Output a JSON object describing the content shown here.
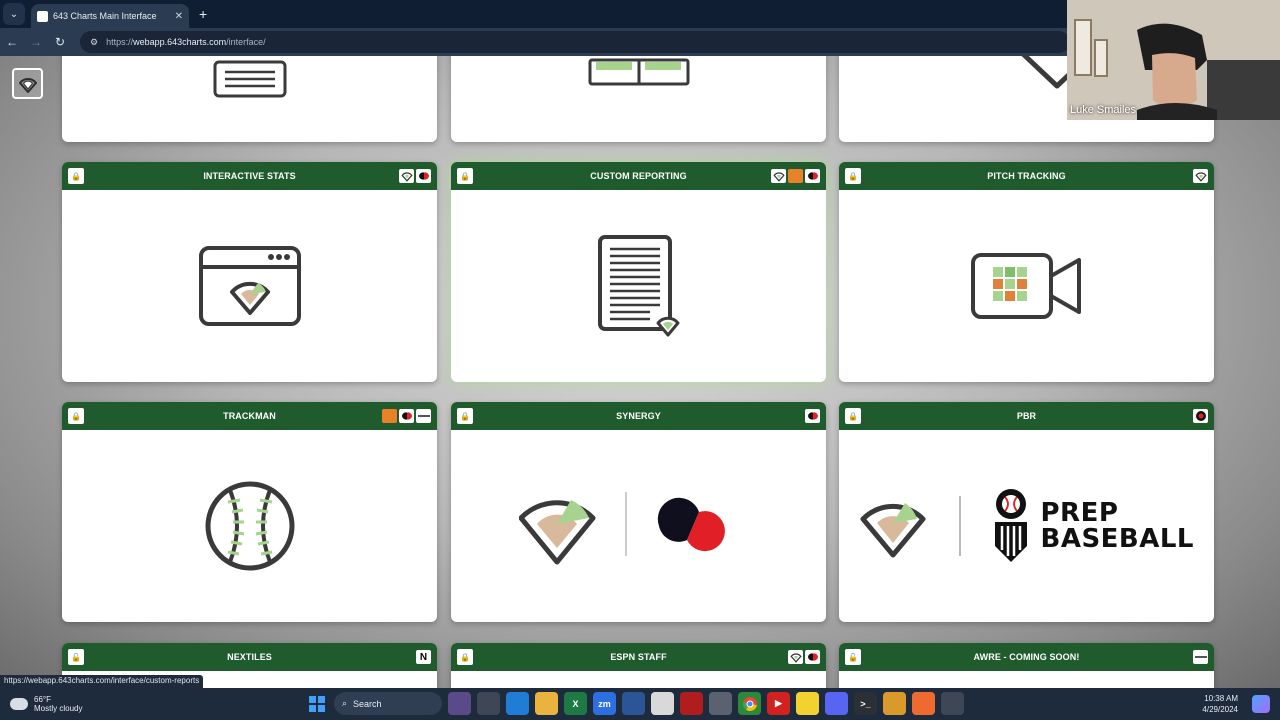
{
  "browser": {
    "tab_title": "643 Charts Main Interface",
    "url_prefix": "https://",
    "url_host": "webapp.643charts.com",
    "url_path": "/interface/"
  },
  "cards": [
    {
      "title": "INTERACTIVE STATS",
      "icon": "browser-window-icon",
      "badges": [
        "643-logo",
        "synergy"
      ]
    },
    {
      "title": "CUSTOM REPORTING",
      "icon": "report-document-icon",
      "badges": [
        "643-logo",
        "orange",
        "synergy"
      ]
    },
    {
      "title": "PITCH TRACKING",
      "icon": "video-camera-icon",
      "badges": [
        "643-logo"
      ]
    },
    {
      "title": "TRACKMAN",
      "icon": "baseball-icon",
      "badges": [
        "orange",
        "synergy",
        "trackman"
      ]
    },
    {
      "title": "SYNERGY",
      "icon": "synergy-logo",
      "badges": [
        "synergy"
      ]
    },
    {
      "title": "PBR",
      "icon": "prep-baseball-logo",
      "badges": [
        "pbr"
      ]
    },
    {
      "title": "NEXTILES",
      "icon": "",
      "badges": [
        "nextiles-n"
      ]
    },
    {
      "title": "ESPN STAFF",
      "icon": "",
      "badges": [
        "643-logo",
        "synergy"
      ]
    },
    {
      "title": "AWRE - COMING SOON!",
      "icon": "",
      "badges": [
        "awre"
      ]
    }
  ],
  "pbr_logo": {
    "line1": "PREP",
    "line2": "BASEBALL"
  },
  "nextiles_badge": "N",
  "webcam": {
    "name": "Luke Smailes"
  },
  "status_url": "https://webapp.643charts.com/interface/custom-reports",
  "taskbar": {
    "weather_temp": "66°F",
    "weather_desc": "Mostly cloudy",
    "search_label": "Search",
    "time": "10:38 AM",
    "date": "4/29/2024"
  },
  "colors": {
    "header_green": "#1f5b2c",
    "field_green": "#a6d38d",
    "field_tan": "#d9b99b",
    "outline": "#3a3a3a"
  }
}
